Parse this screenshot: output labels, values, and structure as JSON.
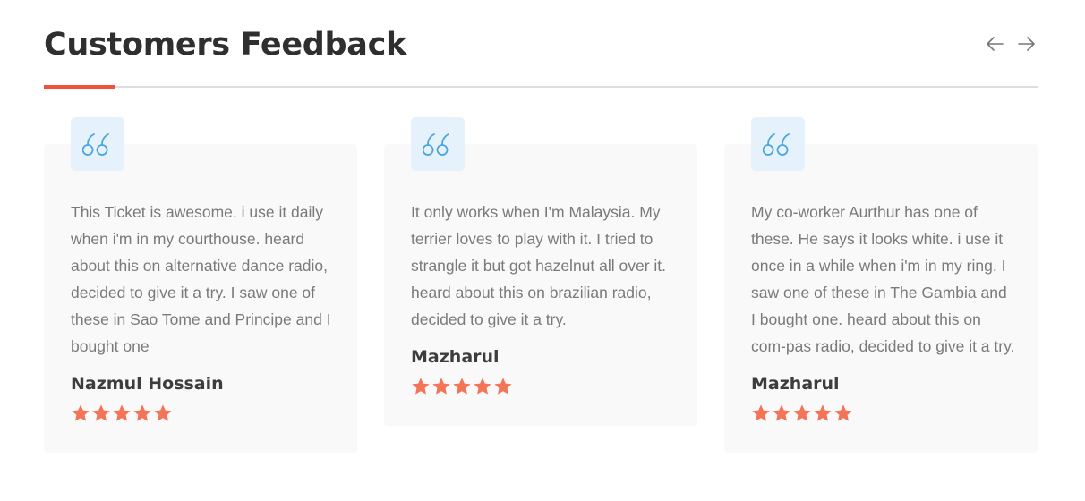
{
  "header": {
    "title": "Customers Feedback",
    "accent_color": "#f0503c",
    "prev_icon": "arrow-left-icon",
    "next_icon": "arrow-right-icon"
  },
  "testimonials": [
    {
      "review": "This Ticket is awesome. i use it daily when i'm in my courthouse. heard about this on alternative dance radio, decided to give it a try. I saw one of these in Sao Tome and Principe and I bought one",
      "author": "Nazmul Hossain",
      "rating": 5
    },
    {
      "review": "It only works when I'm Malaysia. My terrier loves to play with it. I tried to strangle it but got hazelnut all over it. heard about this on brazilian radio, decided to give it a try.",
      "author": "Mazharul",
      "rating": 5
    },
    {
      "review": "My co-worker Aurthur has one of these. He says it looks white. i use it once in a while when i'm in my ring. I saw one of these in The Gambia and I bought one. heard about this on com-pas radio, decided to give it a try.",
      "author": "Mazharul",
      "rating": 5
    }
  ],
  "colors": {
    "star": "#f47458",
    "quote_icon": "#4aa5dc",
    "quote_bg": "#e5f1fb",
    "card_bg": "#f9f9f9"
  }
}
